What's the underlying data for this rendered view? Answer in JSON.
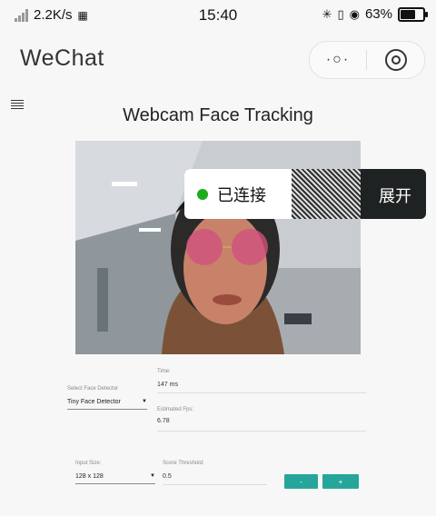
{
  "status": {
    "speed": "2.2K/s",
    "time": "15:40",
    "battery": "63%",
    "battery_level": 0.63
  },
  "header": {
    "app_title": "WeChat",
    "more_label": "·○·"
  },
  "page": {
    "title": "Webcam Face Tracking"
  },
  "overlay": {
    "status": "已连接",
    "expand": "展开"
  },
  "controls": {
    "detector_label": "Select Face Detector",
    "detector_value": "Tiny Face Detector",
    "time_label": "Time:",
    "time_value": "147 ms",
    "fps_label": "Estimated Fps:",
    "fps_value": "6.78",
    "input_size_label": "Input Size:",
    "input_size_value": "128 x 128",
    "threshold_label": "Score Threshold:",
    "threshold_value": "0.5",
    "minus_label": "-",
    "plus_label": "+"
  },
  "colors": {
    "accent": "#26a69a",
    "connected": "#1aad19",
    "toast": "#1f2222"
  }
}
